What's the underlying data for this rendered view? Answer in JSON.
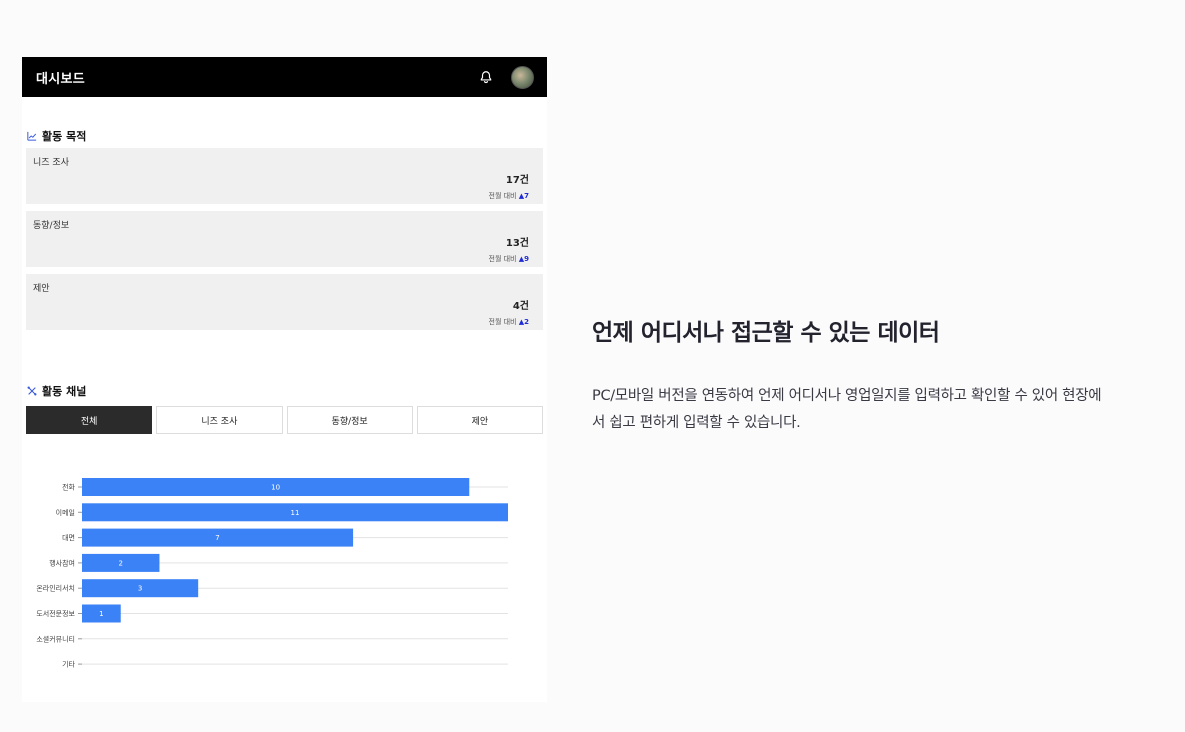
{
  "header": {
    "title": "대시보드"
  },
  "purpose": {
    "heading": "활동 목적",
    "cards": [
      {
        "name": "니즈 조사",
        "count": "17건",
        "delta_label": "전월 대비",
        "delta": "▲7"
      },
      {
        "name": "동향/정보",
        "count": "13건",
        "delta_label": "전월 대비",
        "delta": "▲9"
      },
      {
        "name": "제안",
        "count": "4건",
        "delta_label": "전월 대비",
        "delta": "▲2"
      }
    ]
  },
  "channel": {
    "heading": "활동 채널",
    "tabs": [
      "전체",
      "니즈 조사",
      "동향/정보",
      "제안"
    ],
    "active_tab": 0
  },
  "chart_data": {
    "type": "bar",
    "orientation": "horizontal",
    "categories": [
      "전화",
      "이메일",
      "대면",
      "행사참여",
      "온라인리서치",
      "도서전문정보",
      "소셜커뮤니티",
      "기타"
    ],
    "values": [
      10,
      11,
      7,
      2,
      3,
      1,
      0,
      0
    ],
    "xlim": [
      0,
      11
    ],
    "grid": true,
    "bar_color": "#3b82f6"
  },
  "promo": {
    "headline": "언제 어디서나 접근할 수 있는 데이터",
    "desc_line1": "PC/모바일 버전을 연동하여 언제 어디서나 영업일지를 입력하고 확인할 수 있어 현장에",
    "desc_line2": "서 쉽고 편하게 입력할 수 있습니다."
  }
}
